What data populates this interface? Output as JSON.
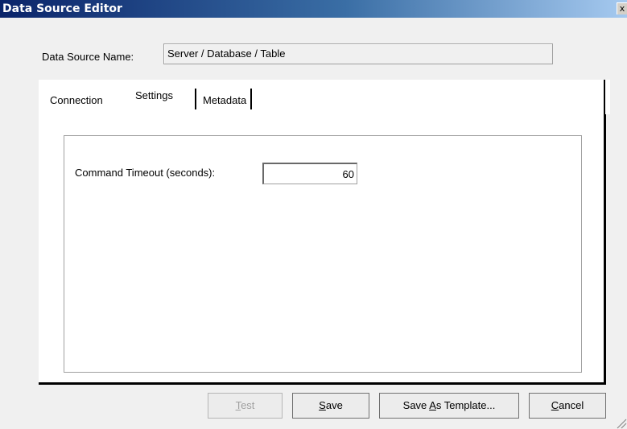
{
  "window": {
    "title": "Data Source Editor",
    "close_glyph": "x"
  },
  "data_source": {
    "label": "Data Source Name:",
    "value": "Server / Database / Table"
  },
  "tabs": [
    {
      "label": "Connection",
      "selected": false
    },
    {
      "label": "Settings",
      "selected": true
    },
    {
      "label": "Metadata",
      "selected": false
    }
  ],
  "settings": {
    "command_timeout_label": "Command Timeout (seconds):",
    "command_timeout_value": "60"
  },
  "buttons": {
    "test": {
      "mnemonic": "T",
      "rest": "est",
      "enabled": false
    },
    "save": {
      "mnemonic": "S",
      "rest": "ave"
    },
    "save_as_template": {
      "prefix": "Save ",
      "mnemonic": "A",
      "rest": "s Template..."
    },
    "cancel": {
      "mnemonic": "C",
      "rest": "ancel"
    }
  },
  "colors": {
    "titlebar_start": "#0a246a",
    "titlebar_end": "#a6caf0",
    "disabled_text": "#a0a0a0"
  }
}
